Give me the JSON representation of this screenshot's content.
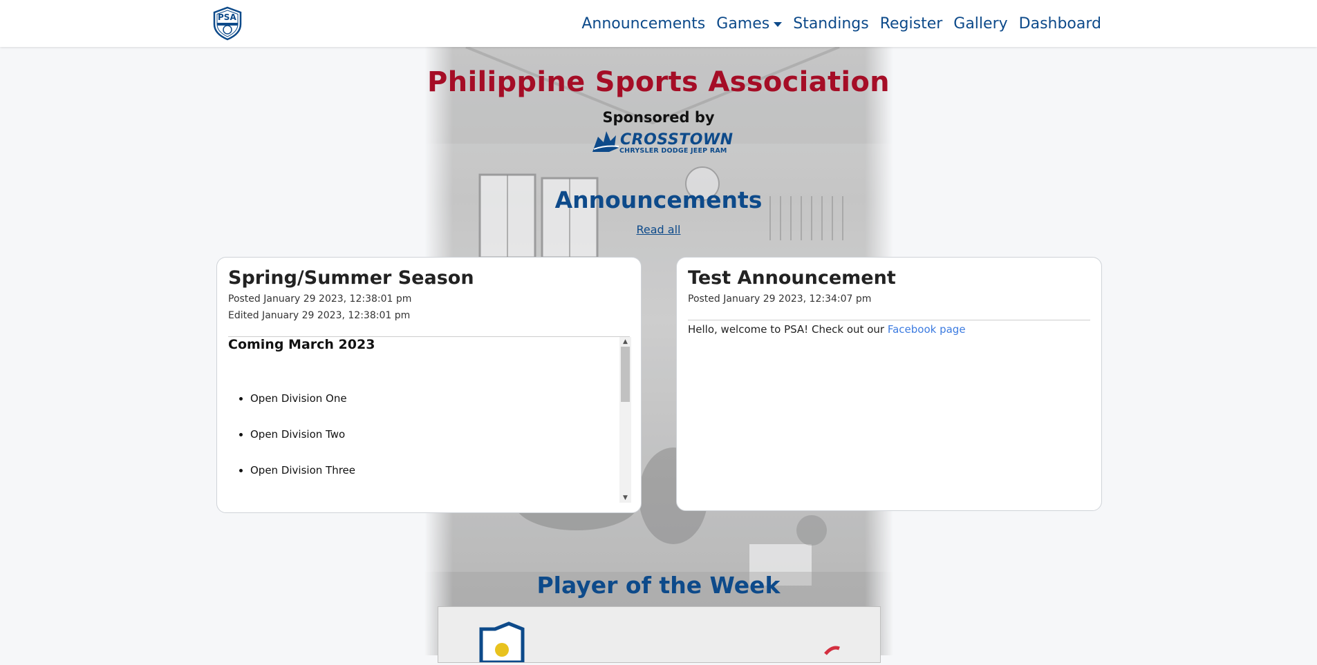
{
  "nav": {
    "logo_text": "PSA",
    "links": [
      {
        "label": "Announcements"
      },
      {
        "label": "Games"
      },
      {
        "label": "Standings"
      },
      {
        "label": "Register"
      },
      {
        "label": "Gallery"
      },
      {
        "label": "Dashboard"
      }
    ]
  },
  "hero": {
    "title": "Philippine Sports Association",
    "sponsored_by": "Sponsored by",
    "sponsor_name": "CROSSTOWN",
    "sponsor_tagline": "CHRYSLER DODGE JEEP RAM"
  },
  "announcements": {
    "heading": "Announcements",
    "read_all": "Read all",
    "cards": [
      {
        "title": "Spring/Summer Season",
        "posted": "Posted January 29 2023, 12:38:01 pm",
        "edited": "Edited January 29 2023, 12:38:01 pm",
        "body_heading": "Coming March 2023",
        "body_items": [
          "Open Division One",
          "Open Division Two",
          "Open Division Three"
        ]
      },
      {
        "title": "Test Announcement",
        "posted": "Posted January 29 2023, 12:34:07 pm",
        "body_text": "Hello, welcome to PSA! Check out our ",
        "body_link": "Facebook page"
      }
    ]
  },
  "player_of_week": {
    "heading": "Player of the Week"
  },
  "colors": {
    "brand_blue": "#0d4a8a",
    "brand_red": "#a50d26",
    "link_blue": "#3c7be0"
  }
}
